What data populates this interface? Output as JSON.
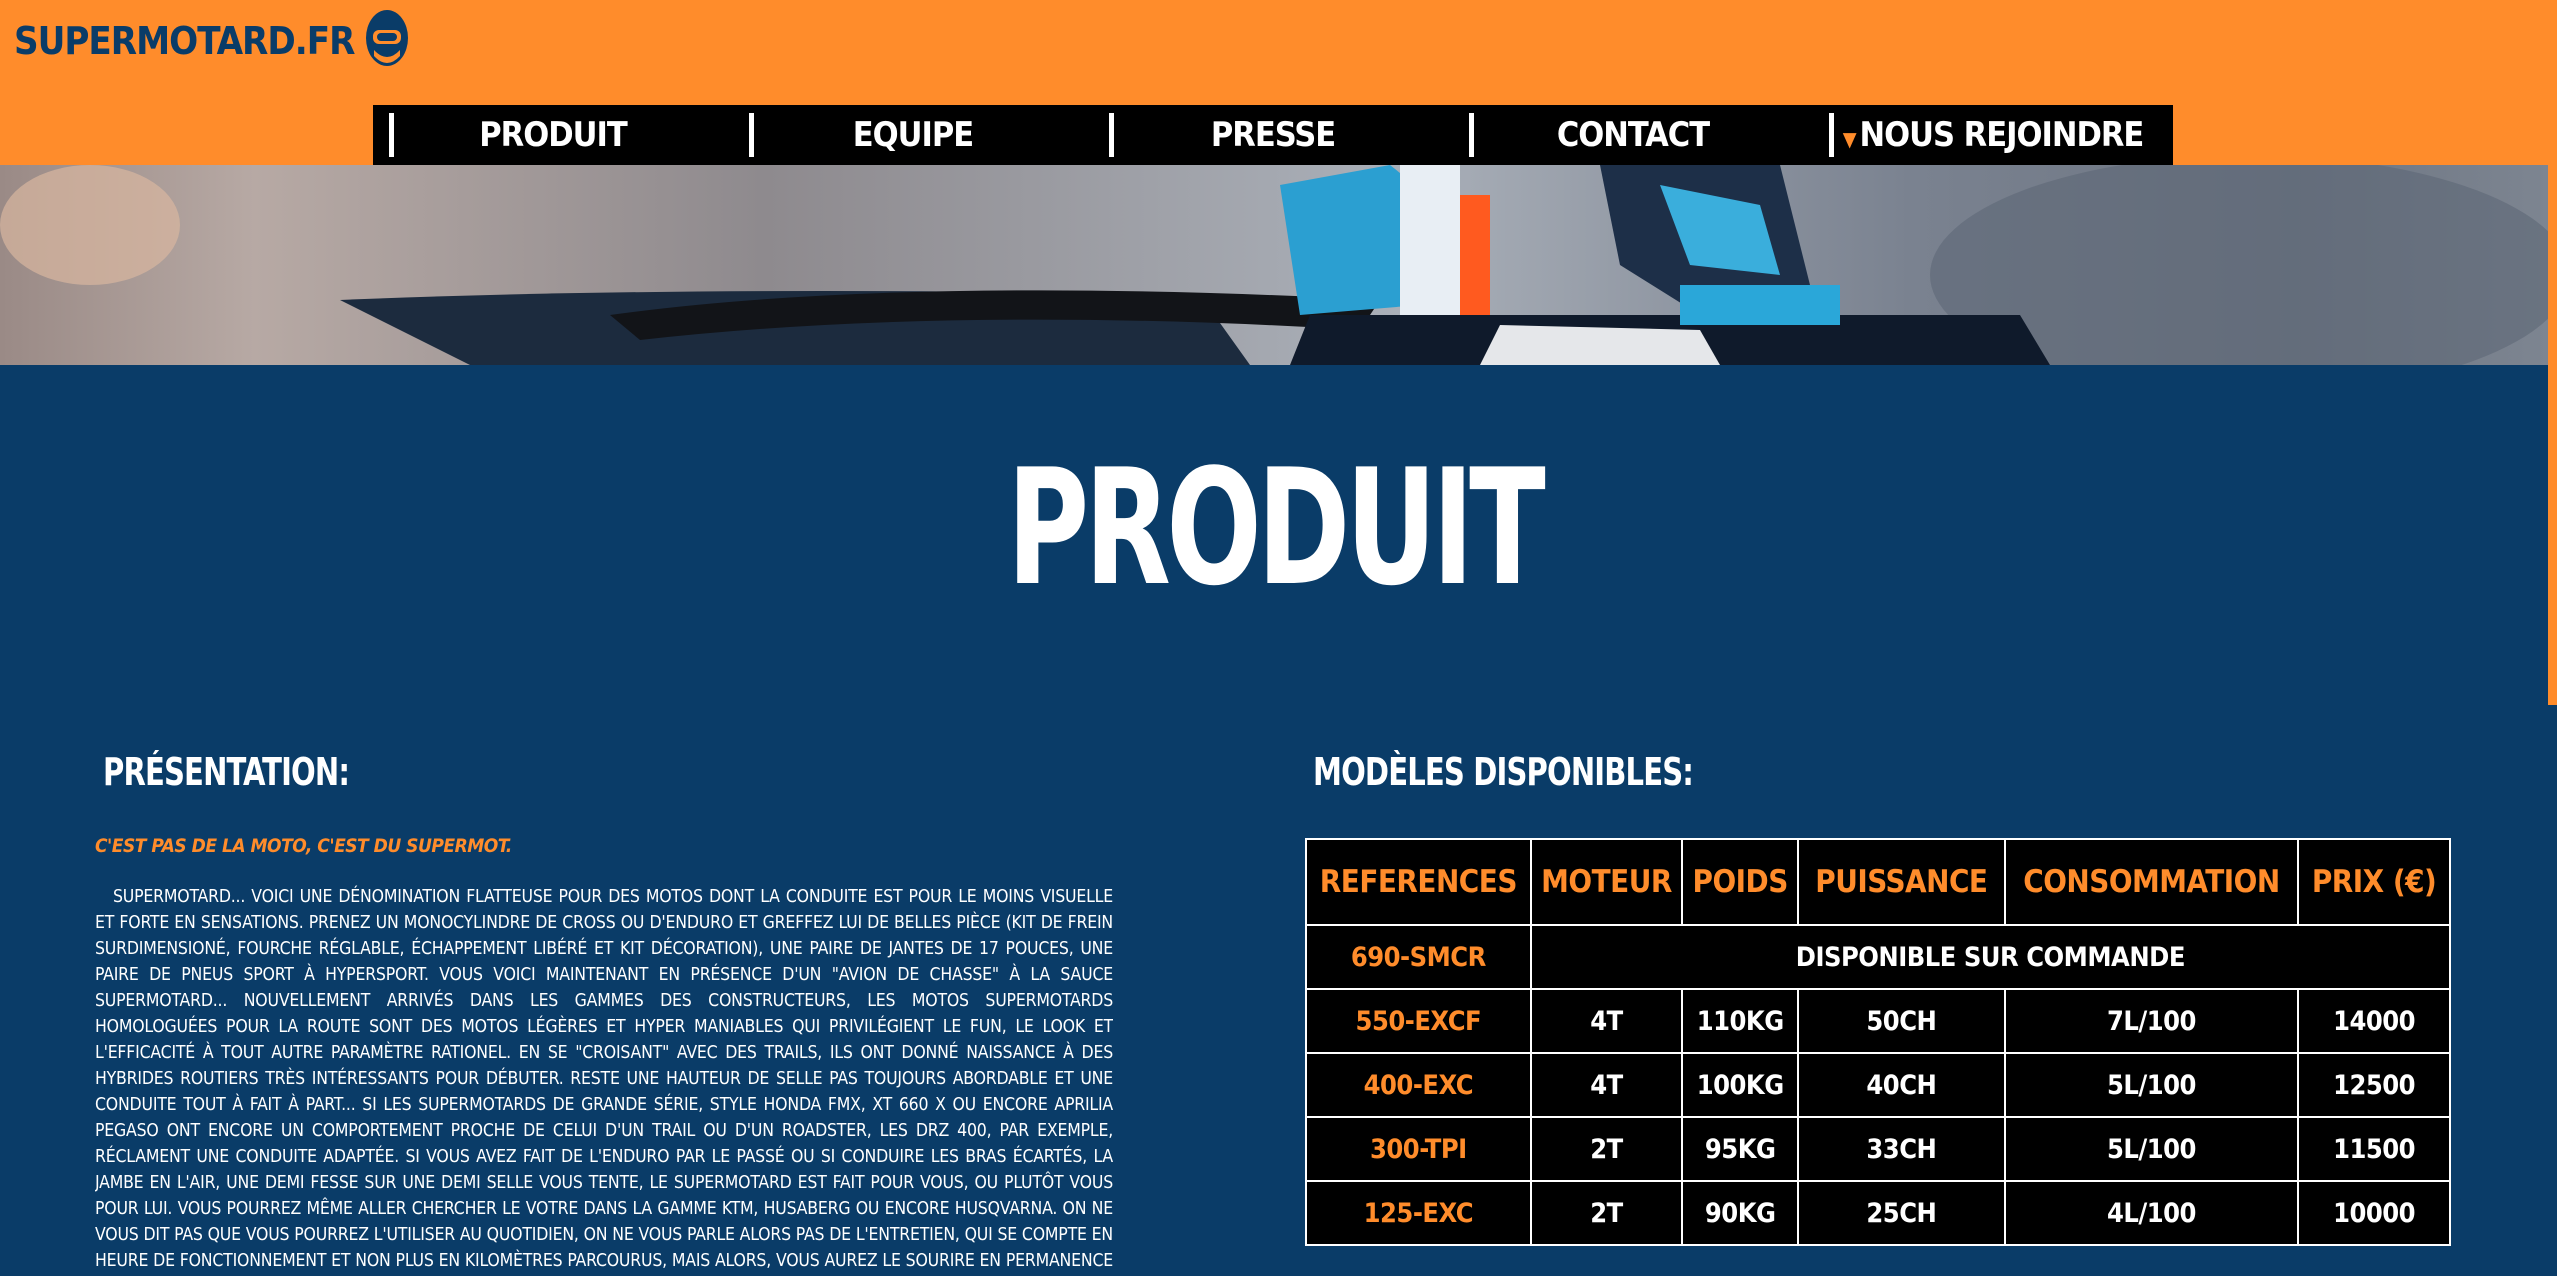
{
  "header": {
    "logo_text": "SUPERMOTARD.FR",
    "colors": {
      "orange": "#ff8c2b",
      "navy": "#0a3c68"
    }
  },
  "nav": {
    "items": [
      {
        "label": "PRODUIT",
        "caret": false
      },
      {
        "label": "EQUIPE",
        "caret": false
      },
      {
        "label": "PRESSE",
        "caret": false
      },
      {
        "label": "CONTACT",
        "caret": false
      },
      {
        "label": "NOUS REJOINDRE",
        "caret": true
      }
    ]
  },
  "page_title": "PRODUIT",
  "presentation": {
    "title": "PRÉSENTATION:",
    "tagline": "C'EST PAS DE LA MOTO, C'EST DU SUPERMOT.",
    "text": "Supermotard... Voici une dénomination flatteuse pour des motos dont la conduite est pour le moins visuelle et forte en sensations. Prenez un monocylindre de cross ou d'enduro et greffez lui de belles pièce (kit de frein surdimensioné, fourche réglable, échappement libéré et kit décoration), une paire de jantes de 17 pouces, une paire de pneus sport à hypersport. Vous voici maintenant en présence d'un \"avion de chasse\" à la sauce supermotard... Nouvellement arrivés dans les gammes des constructeurs, les motos supermotards homologuées pour la route sont des motos légères et hyper maniables qui privilégient le fun, le look et l'efficacité à tout autre paramètre rationel. En se \"croisant\" avec des trails, ils ont donné naissance à des hybrides routiers très intéressants pour débuter. Reste une hauteur de selle pas toujours abordable et une conduite tout à fait à part... Si les supermotards de grande série, style Honda FMX, XT 660 X ou encore Aprilia Pegaso ont encore un comportement proche de celui d'un trail ou d'un roadster, les DRZ 400, par exemple, réclament une conduite adaptée. Si vous avez fait de l'enduro par le passé ou si conduire les bras écartés, la jambe en l'air, une demi fesse sur une demi selle vous tente, le supermotard est fait pour vous, ou plutôt vous pour lui. Vous pourrez même aller chercher le votre dans la gamme KTM, Husaberg ou encore Husqvarna. On ne vous dit pas que vous pourrez l'utiliser au quotidien, on ne vous parle alors pas de l'entretien, qui se compte en heure de fonctionnement et non plus en kilomètres parcourus, mais alors, vous aurez le sourire en permanence et un look approprié, casque cross, lunettes de cross et tout le toutim."
  },
  "models": {
    "title": "MODÈLES DISPONIBLES:",
    "headers": [
      "REFERENCES",
      "MOTEUR",
      "POIDS",
      "PUISSANCE",
      "CONSOMMATION",
      "PRIX (€)"
    ],
    "first_row": {
      "ref": "690-SMCR",
      "note": "DISPONIBLE SUR COMMANDE"
    },
    "rows": [
      [
        "550-EXCF",
        "4T",
        "110KG",
        "50CH",
        "7L/100",
        "14000"
      ],
      [
        "400-EXC",
        "4T",
        "100KG",
        "40CH",
        "5L/100",
        "12500"
      ],
      [
        "300-TPI",
        "2T",
        "95KG",
        "33CH",
        "5L/100",
        "11500"
      ],
      [
        "125-EXC",
        "2T",
        "90KG",
        "25CH",
        "4L/100",
        "10000"
      ]
    ]
  }
}
